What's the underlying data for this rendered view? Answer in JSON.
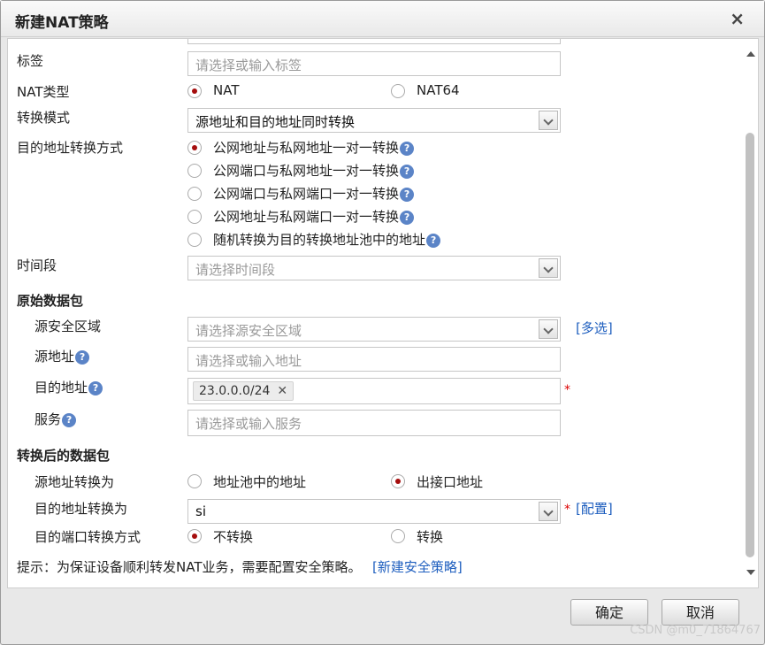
{
  "dialog": {
    "title": "新建NAT策略",
    "close_glyph": "×"
  },
  "form": {
    "tags": {
      "label": "标签",
      "placeholder": "请选择或输入标签"
    },
    "nat_type": {
      "label": "NAT类型",
      "options": [
        "NAT",
        "NAT64"
      ],
      "selected": "NAT"
    },
    "mode": {
      "label": "转换模式",
      "value": "源地址和目的地址同时转换"
    },
    "dest_method": {
      "label": "目的地址转换方式",
      "options": [
        "公网地址与私网地址一对一转换",
        "公网端口与私网地址一对一转换",
        "公网端口与私网端口一对一转换",
        "公网地址与私网端口一对一转换",
        "随机转换为目的转换地址池中的地址"
      ],
      "selected_index": 0
    },
    "time": {
      "label": "时间段",
      "placeholder": "请选择时间段"
    },
    "original_section": "原始数据包",
    "src_zone": {
      "label": "源安全区域",
      "placeholder": "请选择源安全区域",
      "link": "[多选]"
    },
    "src_addr": {
      "label": "源地址",
      "placeholder": "请选择或输入地址"
    },
    "dst_addr": {
      "label": "目的地址",
      "tag": "23.0.0.0/24",
      "required": "*"
    },
    "service": {
      "label": "服务",
      "placeholder": "请选择或输入服务"
    },
    "translated_section": "转换后的数据包",
    "src_trans": {
      "label": "源地址转换为",
      "options": [
        "地址池中的地址",
        "出接口地址"
      ],
      "selected_index": 1
    },
    "dst_trans": {
      "label": "目的地址转换为",
      "value": "si",
      "required": "*",
      "link": "[配置]"
    },
    "port_trans": {
      "label": "目的端口转换方式",
      "options": [
        "不转换",
        "转换"
      ],
      "selected_index": 0
    },
    "hint": {
      "text": "提示：为保证设备顺利转发NAT业务，需要配置安全策略。",
      "link": "[新建安全策略]"
    }
  },
  "buttons": {
    "ok": "确定",
    "cancel": "取消"
  },
  "help_glyph": "?",
  "watermark": "CSDN @m0_71864767",
  "colors": {
    "radio_selected": "#a50d0d",
    "link": "#1f5fbf",
    "help_icon": "#5b84c7",
    "required": "#dd0000"
  }
}
